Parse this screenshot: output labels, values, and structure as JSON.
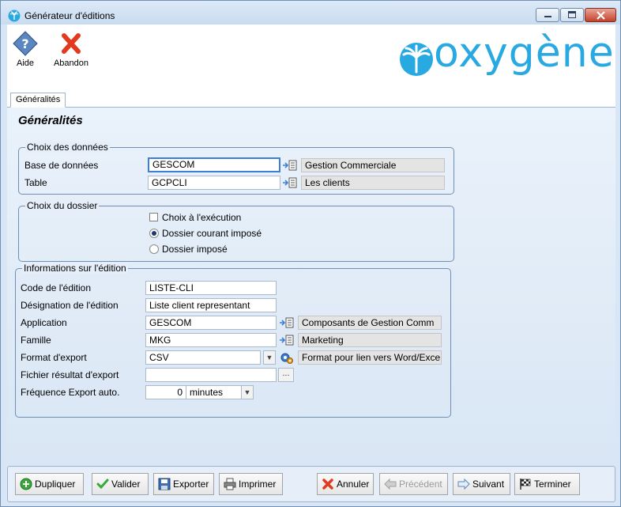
{
  "window": {
    "title": "Générateur d'éditions"
  },
  "toolbar": {
    "help_label": "Aide",
    "abort_label": "Abandon",
    "brand": "oxygène"
  },
  "tabs": [
    {
      "label": "Généralités"
    }
  ],
  "section_title": "Généralités",
  "data_choice": {
    "legend": "Choix des données",
    "database": {
      "label": "Base de données",
      "value": "GESCOM",
      "desc": "Gestion Commerciale"
    },
    "table": {
      "label": "Table",
      "value": "GCPCLI",
      "desc": "Les clients"
    }
  },
  "folder_choice": {
    "legend": "Choix du dossier",
    "checkbox": "Choix à l'exécution",
    "radio_current": "Dossier courant imposé",
    "radio_imposed": "Dossier imposé"
  },
  "edition_info": {
    "legend": "Informations sur l'édition",
    "code": {
      "label": "Code de l'édition",
      "value": "LISTE-CLI"
    },
    "designation": {
      "label": "Désignation de l'édition",
      "value": "Liste client representant"
    },
    "application": {
      "label": "Application",
      "value": "GESCOM",
      "desc": "Composants de Gestion Comm"
    },
    "family": {
      "label": "Famille",
      "value": "MKG",
      "desc": "Marketing"
    },
    "export_format": {
      "label": "Format d'export",
      "value": "CSV",
      "desc": "Format pour lien vers Word/Exce"
    },
    "result_file": {
      "label": "Fichier résultat d'export",
      "value": "",
      "browse": "..."
    },
    "frequency": {
      "label": "Fréquence Export auto.",
      "value": "0",
      "unit": "minutes"
    }
  },
  "footer": {
    "duplicate": "Dupliquer",
    "validate": "Valider",
    "export": "Exporter",
    "print": "Imprimer",
    "cancel": "Annuler",
    "previous": "Précédent",
    "next": "Suivant",
    "finish": "Terminer"
  },
  "colors": {
    "brand": "#29a9e1",
    "accent": "#3c7fd6",
    "close": "#c4412b"
  }
}
